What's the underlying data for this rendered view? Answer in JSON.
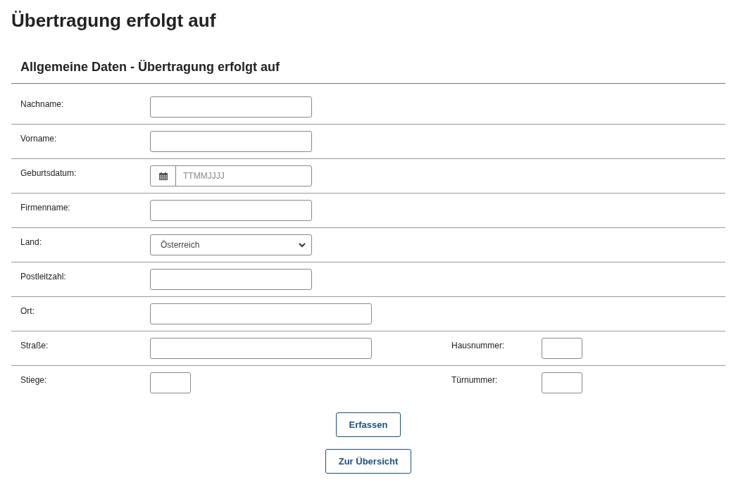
{
  "title": "Übertragung erfolgt auf",
  "section": {
    "heading": "Allgemeine Daten - Übertragung erfolgt auf",
    "rows": [
      {
        "fields": [
          {
            "label": "Nachname:",
            "kind": "text"
          }
        ]
      },
      {
        "fields": [
          {
            "label": "Vorname:",
            "kind": "text"
          }
        ]
      },
      {
        "fields": [
          {
            "label": "Geburtsdatum:",
            "kind": "date",
            "placeholder": "TTMMJJJJ"
          }
        ]
      },
      {
        "fields": [
          {
            "label": "Firmenname:",
            "kind": "text"
          }
        ]
      },
      {
        "fields": [
          {
            "label": "Land:",
            "kind": "select",
            "value": "Österreich"
          }
        ]
      },
      {
        "fields": [
          {
            "label": "Postleitzahl:",
            "kind": "text"
          }
        ]
      },
      {
        "fields": [
          {
            "label": "Ort:",
            "kind": "longtext"
          }
        ]
      },
      {
        "fields": [
          {
            "label": "Straße:",
            "kind": "longtext"
          },
          {
            "label": "Hausnummer:",
            "kind": "shorttext"
          }
        ]
      },
      {
        "fields": [
          {
            "label": "Stiege:",
            "kind": "shorttext"
          },
          {
            "label": "Türnummer:",
            "kind": "shorttext"
          }
        ]
      }
    ]
  },
  "buttons": [
    "Erfassen",
    "Zur Übersicht"
  ]
}
